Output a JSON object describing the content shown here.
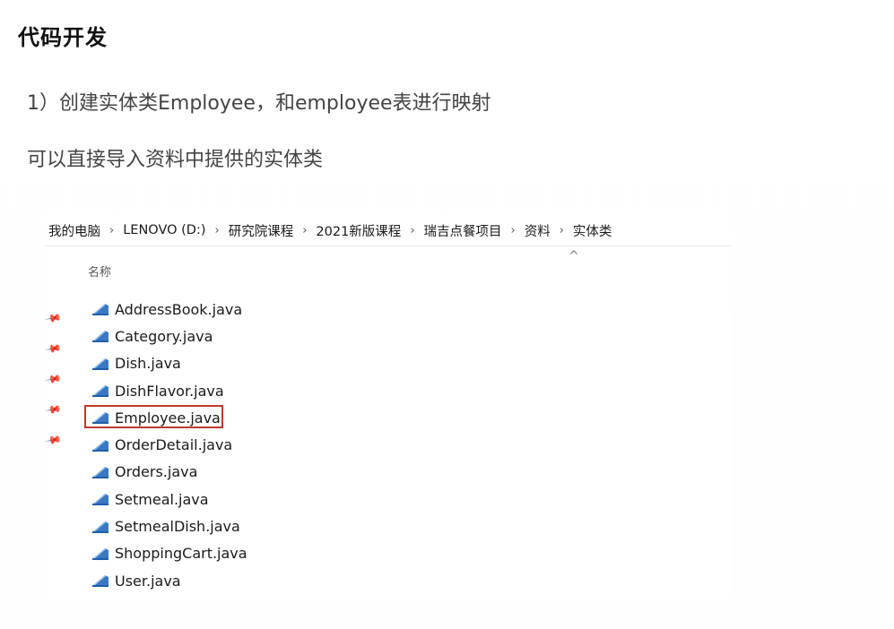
{
  "heading": "代码开发",
  "paragraphs": {
    "step1": "1）创建实体类Employee，和employee表进行映射",
    "note": "可以直接导入资料中提供的实体类"
  },
  "explorer": {
    "breadcrumb": [
      "我的电脑",
      "LENOVO (D:)",
      "研究院课程",
      "2021新版课程",
      "瑞吉点餐项目",
      "资料",
      "实体类"
    ],
    "separator": "›",
    "column_header": "名称",
    "sort_indicator": "^",
    "pin_icon": "pin-icon",
    "file_icon": "java-file-icon",
    "highlight_color": "#c0392b",
    "highlighted_file": "Employee.java",
    "files": [
      "AddressBook.java",
      "Category.java",
      "Dish.java",
      "DishFlavor.java",
      "Employee.java",
      "OrderDetail.java",
      "Orders.java",
      "Setmeal.java",
      "SetmealDish.java",
      "ShoppingCart.java",
      "User.java"
    ]
  }
}
